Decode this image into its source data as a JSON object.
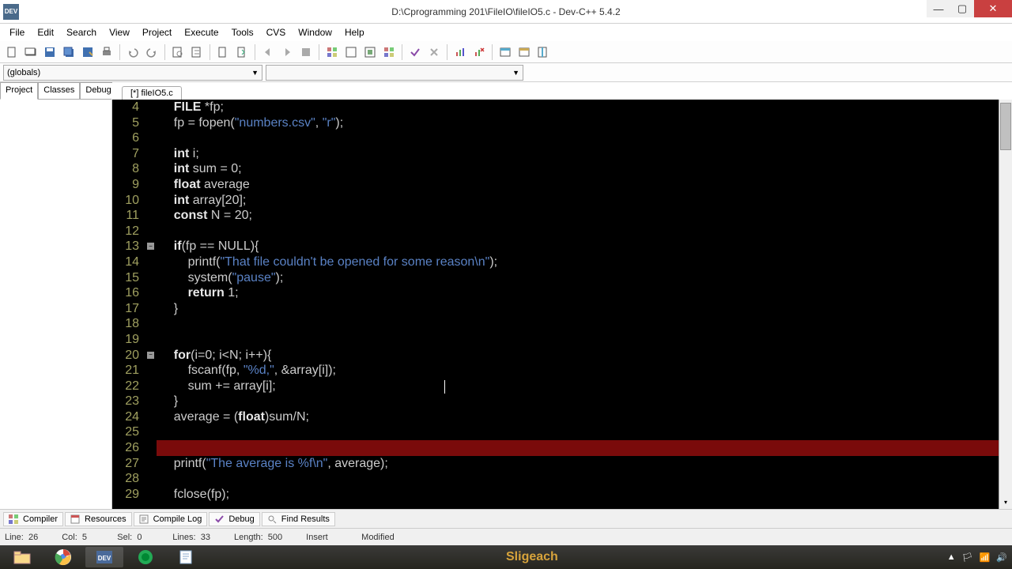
{
  "titlebar": {
    "title": "D:\\Cprogramming 201\\FileIO\\fileIO5.c - Dev-C++ 5.4.2",
    "app_icon_text": "DEV"
  },
  "menu": {
    "items": [
      "File",
      "Edit",
      "Search",
      "View",
      "Project",
      "Execute",
      "Tools",
      "CVS",
      "Window",
      "Help"
    ]
  },
  "combos": {
    "left": "(globals)",
    "right": ""
  },
  "sidebar": {
    "tabs": [
      "Project",
      "Classes",
      "Debug"
    ]
  },
  "file_tab": {
    "label": "[*] fileIO5.c"
  },
  "code": {
    "first_line": 4,
    "current_line": 26,
    "lines": [
      {
        "n": 4,
        "html": "    <span class='t'>FILE</span> *fp;"
      },
      {
        "n": 5,
        "html": "    fp = fopen(<span class='s'>\"numbers.csv\"</span>, <span class='s'>\"r\"</span>);"
      },
      {
        "n": 6,
        "html": ""
      },
      {
        "n": 7,
        "html": "    <span class='t'>int</span> i;"
      },
      {
        "n": 8,
        "html": "    <span class='t'>int</span> sum = 0;"
      },
      {
        "n": 9,
        "html": "    <span class='t'>float</span> average"
      },
      {
        "n": 10,
        "html": "    <span class='t'>int</span> array[20];"
      },
      {
        "n": 11,
        "html": "    <span class='t'>const</span> N = 20;"
      },
      {
        "n": 12,
        "html": ""
      },
      {
        "n": 13,
        "html": "    <span class='k'>if</span>(fp == NULL){",
        "fold": true
      },
      {
        "n": 14,
        "html": "        printf(<span class='s'>\"That file couldn't be opened for some reason\\n\"</span>);"
      },
      {
        "n": 15,
        "html": "        system(<span class='s'>\"pause\"</span>);"
      },
      {
        "n": 16,
        "html": "        <span class='k'>return</span> 1;"
      },
      {
        "n": 17,
        "html": "    }"
      },
      {
        "n": 18,
        "html": ""
      },
      {
        "n": 19,
        "html": ""
      },
      {
        "n": 20,
        "html": "    <span class='k'>for</span>(i=0; i&lt;N; i++){",
        "fold": true
      },
      {
        "n": 21,
        "html": "        fscanf(fp, <span class='s'>\"%d,\"</span>, &amp;array[i]);"
      },
      {
        "n": 22,
        "html": "        sum += array[i];"
      },
      {
        "n": 23,
        "html": "    }"
      },
      {
        "n": 24,
        "html": "    average = (<span class='t'>float</span>)sum/N;"
      },
      {
        "n": 25,
        "html": ""
      },
      {
        "n": 26,
        "html": "    "
      },
      {
        "n": 27,
        "html": "    printf(<span class='s'>\"The average is %f\\n\"</span>, average);"
      },
      {
        "n": 28,
        "html": ""
      },
      {
        "n": 29,
        "html": "    fclose(fp);"
      }
    ],
    "cursor_col": 38
  },
  "bottom_tabs": {
    "items": [
      "Compiler",
      "Resources",
      "Compile Log",
      "Debug",
      "Find Results"
    ]
  },
  "status": {
    "line_lbl": "Line:",
    "line": "26",
    "col_lbl": "Col:",
    "col": "5",
    "sel_lbl": "Sel:",
    "sel": "0",
    "lines_lbl": "Lines:",
    "lines": "33",
    "len_lbl": "Length:",
    "len": "500",
    "insert": "Insert",
    "modified": "Modified"
  },
  "taskbar": {
    "bg_word1": "",
    "bg_word2": "Sligeach"
  },
  "tray": {
    "time": ""
  }
}
